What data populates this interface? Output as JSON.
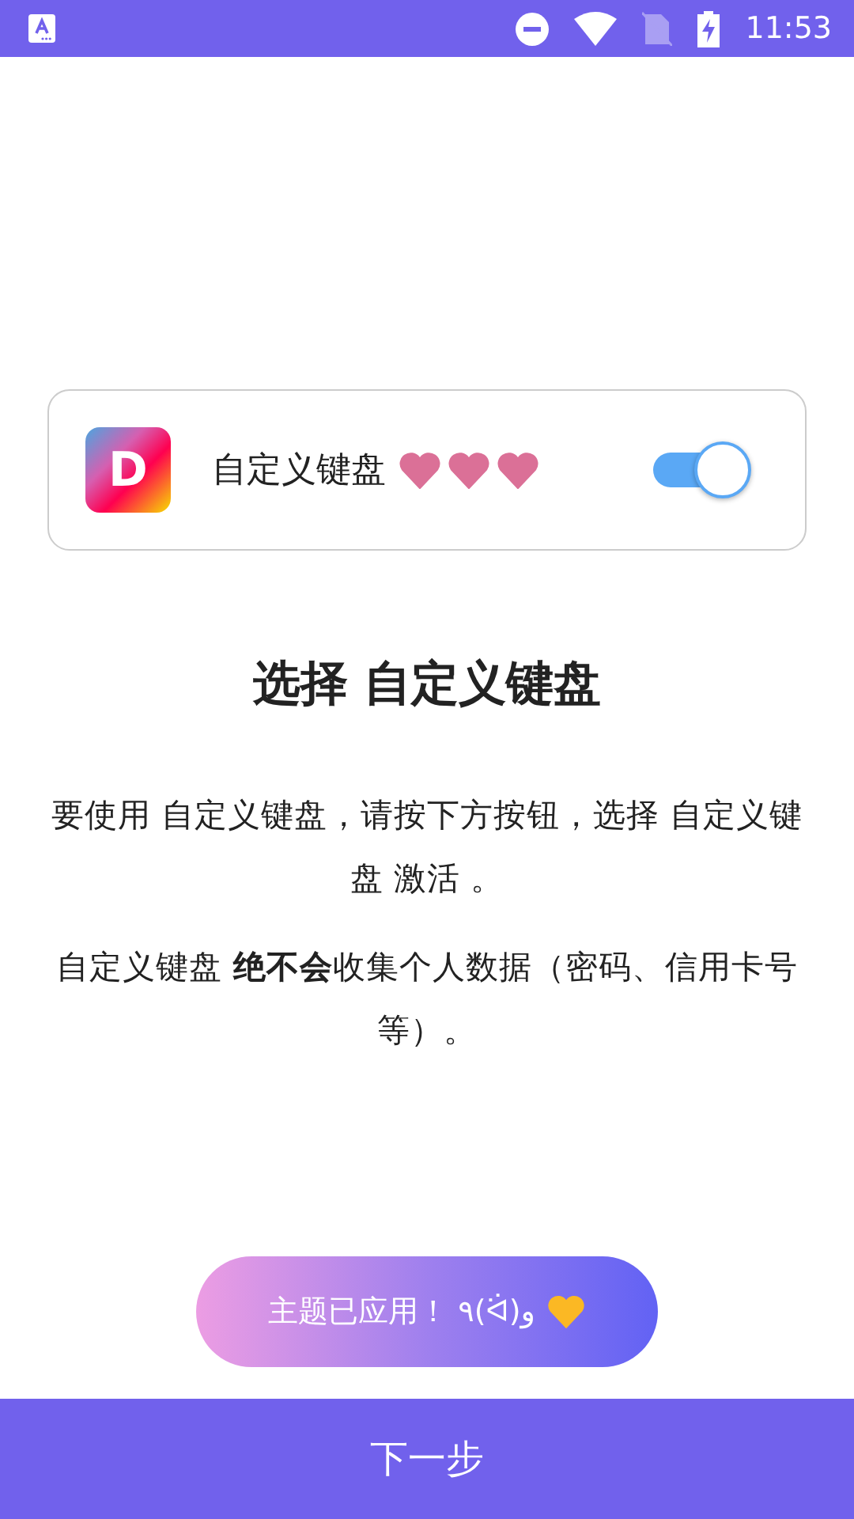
{
  "status_bar": {
    "time": "11:53"
  },
  "keyboard_card": {
    "name": "自定义键盘",
    "app_letter": "D",
    "enabled": true
  },
  "title": "选择 自定义键盘",
  "paragraphs": [
    "要使用 自定义键盘，请按下方按钮，选择 自定义键盘 激活 。",
    "自定义键盘 **绝不会**收集个人数据（密码、信用卡号等）。"
  ],
  "theme_button": {
    "label": "主题已应用！ ٩(ᐛ)و"
  },
  "next_button": {
    "label": "下一步"
  }
}
